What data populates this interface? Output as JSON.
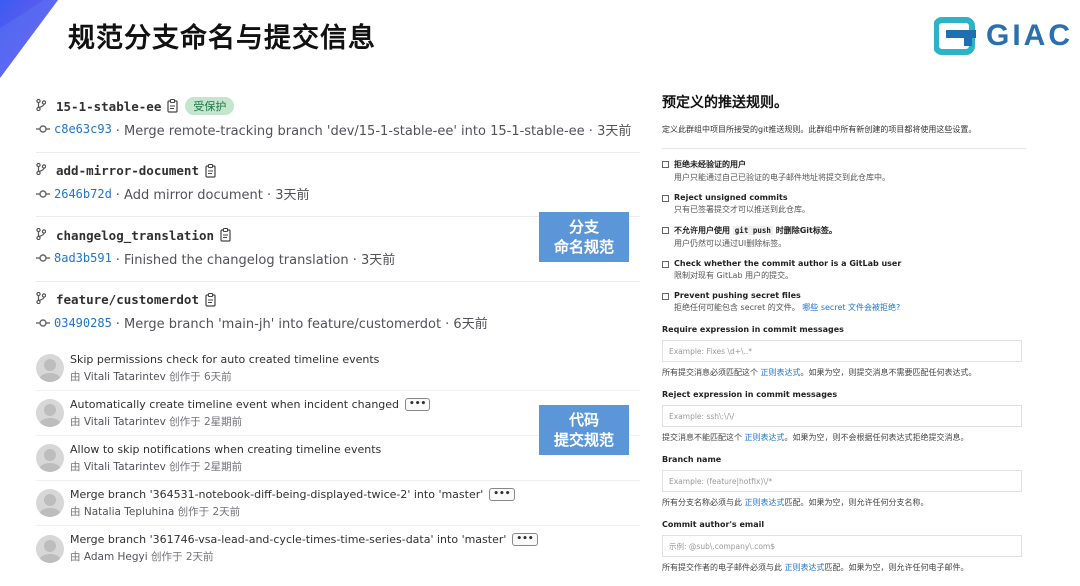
{
  "slide": {
    "title": "规范分支命名与提交信息",
    "logo_text": "GIAC",
    "accent_color": "#4a6cf7"
  },
  "branches": [
    {
      "name": "15-1-stable-ee",
      "badge": "受保护",
      "sha": "c8e63c93",
      "message": "· Merge remote-tracking branch 'dev/15-1-stable-ee' into 15-1-stable-ee · 3天前"
    },
    {
      "name": "add-mirror-document",
      "badge": "",
      "sha": "2646b72d",
      "message": "· Add mirror document · 3天前"
    },
    {
      "name": "changelog_translation",
      "badge": "",
      "sha": "8ad3b591",
      "message": "· Finished the changelog translation · 3天前"
    },
    {
      "name": "feature/customerdot",
      "badge": "",
      "sha": "03490285",
      "message": "· Merge branch 'main-jh' into feature/customerdot · 6天前"
    }
  ],
  "commits": [
    {
      "title": "Skip permissions check for auto created timeline events",
      "by": "由",
      "author": "Vitali Tatarintev",
      "time": "创作于 6天前",
      "more": ""
    },
    {
      "title": "Automatically create timeline event when incident changed",
      "by": "由",
      "author": "Vitali Tatarintev",
      "time": "创作于 2星期前",
      "more": "•••"
    },
    {
      "title": "Allow to skip notifications when creating timeline events",
      "by": "由",
      "author": "Vitali Tatarintev",
      "time": "创作于 2星期前",
      "more": ""
    },
    {
      "title": "Merge branch '364531-notebook-diff-being-displayed-twice-2' into 'master'",
      "by": "由",
      "author": "Natalia Tepluhina",
      "time": "创作于 2天前",
      "more": "•••"
    },
    {
      "title": "Merge branch '361746-vsa-lead-and-cycle-times-time-series-data' into 'master'",
      "by": "由",
      "author": "Adam Hegyi",
      "time": "创作于 2天前",
      "more": "•••"
    }
  ],
  "labels": {
    "branch_label_1": "分支",
    "branch_label_2": "命名规范",
    "commit_label_1": "代码",
    "commit_label_2": "提交规范",
    "color": "#5b96d8"
  },
  "rules": {
    "title": "预定义的推送规则。",
    "description": "定义此群组中项目所接受的git推送规则。此群组中所有新创建的项目都将使用这些设置。",
    "checks": [
      {
        "label": "拒绝未经验证的用户",
        "help": "用户只能通过自己已验证的电子邮件地址将提交到此仓库中。",
        "help_link": ""
      },
      {
        "label": "Reject unsigned commits",
        "help": "只有已签署提交才可以推送到此仓库。",
        "help_link": ""
      },
      {
        "label_pre": "不允许用户使用",
        "label_code": "git push",
        "label_post": "时删除Git标签。",
        "help": "用户仍然可以通过UI删除标签。",
        "help_link": ""
      },
      {
        "label": "Check whether the commit author is a GitLab user",
        "help": "限制对现有 GitLab 用户的提交。",
        "help_link": ""
      },
      {
        "label": "Prevent pushing secret files",
        "help": "拒绝任何可能包含 secret 的文件。",
        "help_link": "哪些 secret 文件会被拒绝?"
      }
    ],
    "fields": [
      {
        "label": "Require expression in commit messages",
        "placeholder": "Example: Fixes \\d+\\..*",
        "help_pre": "所有提交消息必须匹配这个",
        "help_link": "正则表达式",
        "help_post": "。如果为空，则提交消息不需要匹配任何表达式。"
      },
      {
        "label": "Reject expression in commit messages",
        "placeholder": "Example: ssh\\:\\/\\/",
        "help_pre": "提交消息不能匹配这个",
        "help_link": "正则表达式",
        "help_post": "。如果为空，则不会根据任何表达式拒绝提交消息。"
      },
      {
        "label": "Branch name",
        "placeholder": "Example: (feature|hotfix)\\/*",
        "help_pre": "所有分支名称必须与此",
        "help_link": "正则表达式",
        "help_post": "匹配。如果为空，则允许任何分支名称。"
      },
      {
        "label": "Commit author's email",
        "placeholder": "示例: @sub\\.company\\.com$",
        "help_pre": "所有提交作者的电子邮件必须与此",
        "help_link": "正则表达式",
        "help_post": "匹配。如果为空，则允许任何电子邮件。"
      }
    ]
  }
}
